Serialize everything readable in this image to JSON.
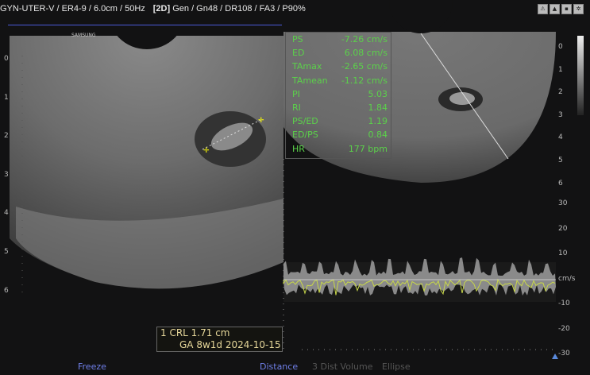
{
  "header": {
    "preset": "GYN-UTER-V / ER4-9 / 6.0cm / 50Hz",
    "mode": "[2D]",
    "params": "Gen / Gn48 / DR108 / FA3 / P90%"
  },
  "status_icons": [
    "probe-icon",
    "bell-icon",
    "pwr-icon",
    "gear-icon"
  ],
  "measurements": [
    {
      "k": "PS",
      "v": "-7.26 cm/s"
    },
    {
      "k": "ED",
      "v": "6.08 cm/s"
    },
    {
      "k": "TAmax",
      "v": "-2.65 cm/s"
    },
    {
      "k": "TAmean",
      "v": "-1.12 cm/s"
    },
    {
      "k": "PI",
      "v": "5.03"
    },
    {
      "k": "RI",
      "v": "1.84"
    },
    {
      "k": "PS/ED",
      "v": "1.19"
    },
    {
      "k": "ED/PS",
      "v": "0.84"
    },
    {
      "k": "HR",
      "v": "177 bpm"
    }
  ],
  "result": {
    "line1": "1  CRL  1.71 cm",
    "line2": "GA 8w1d 2024-10-15"
  },
  "left_depth_scale": [
    "0",
    "1",
    "2",
    "3",
    "4",
    "5",
    "6"
  ],
  "right_depth_scale": [
    "0",
    "1",
    "2",
    "3",
    "4",
    "5",
    "6"
  ],
  "velocity_scale": [
    "30",
    "20",
    "10",
    "cm/s",
    "-10",
    "-20",
    "-30"
  ],
  "footer": {
    "freeze": "Freeze",
    "distance": "Distance",
    "dist3": "3 Dist Volume",
    "ellipse": "Ellipse"
  },
  "probe_brand": "SAMSUNG",
  "colors": {
    "accent": "#4a5ad8",
    "measure": "#5bd14a",
    "result": "#e6d79a"
  }
}
